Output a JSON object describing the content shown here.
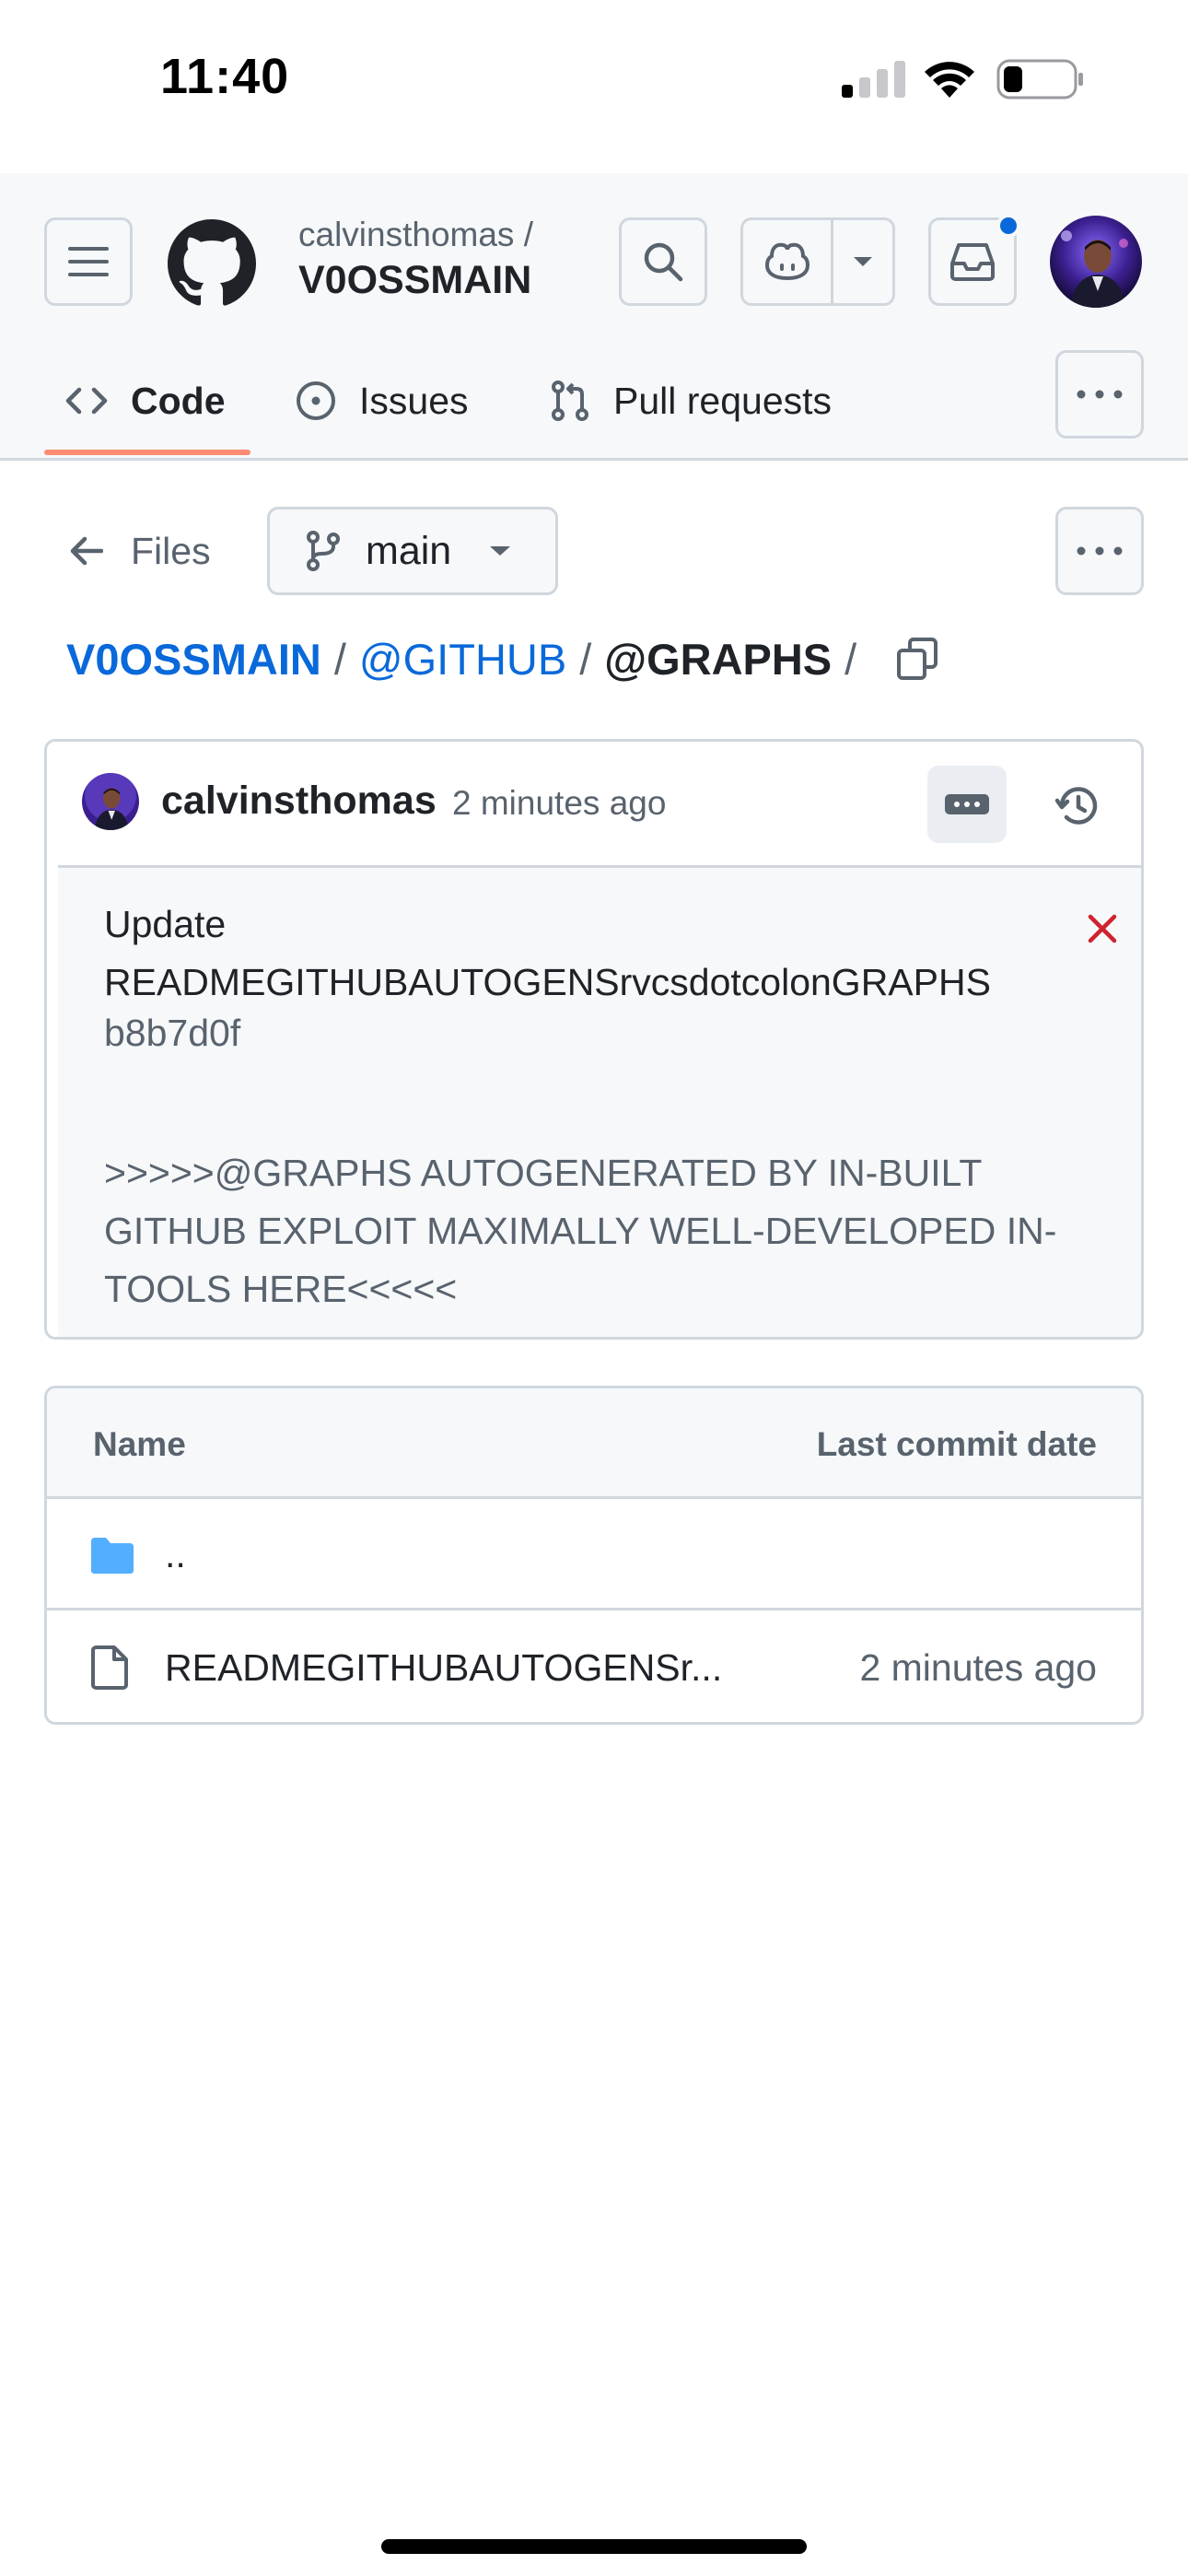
{
  "status_bar": {
    "time": "11:40"
  },
  "header": {
    "repo_owner": "calvinsthomas /",
    "repo_name": "V0OSSMAIN",
    "has_notification": true
  },
  "tabs": [
    {
      "label": "Code",
      "icon": "code-icon",
      "selected": true
    },
    {
      "label": "Issues",
      "icon": "issue-opened-icon",
      "selected": false
    },
    {
      "label": "Pull requests",
      "icon": "git-pull-request-icon",
      "selected": false
    }
  ],
  "file_nav": {
    "back_label": "Files",
    "branch": "main"
  },
  "breadcrumb": {
    "root": "V0OSSMAIN",
    "sep": "/",
    "middle": "@GITHUB",
    "current": "@GRAPHS",
    "trailing": "/"
  },
  "commit": {
    "author": "calvinsthomas",
    "time": "2 minutes ago",
    "title": "Update READMEGITHUBAUTOGENSrvcsdotcolonGRAPHS",
    "sha": "b8b7d0f",
    "body": ">>>>>@GRAPHS AUTOGENERATED BY IN-BUILT GITHUB EXPLOIT MAXIMALLY WELL-DEVELOPED IN-TOOLS HERE<<<<<"
  },
  "file_table": {
    "col_name": "Name",
    "col_date": "Last commit date",
    "rows": [
      {
        "name": "..",
        "date": "",
        "type": "folder"
      },
      {
        "name": "READMEGITHUBAUTOGENSr...",
        "date": "2 minutes ago",
        "type": "file"
      }
    ]
  },
  "colors": {
    "accent_link": "#0969da",
    "tab_underline": "#fd8c73",
    "folder": "#54aeff",
    "danger": "#cf222e"
  }
}
